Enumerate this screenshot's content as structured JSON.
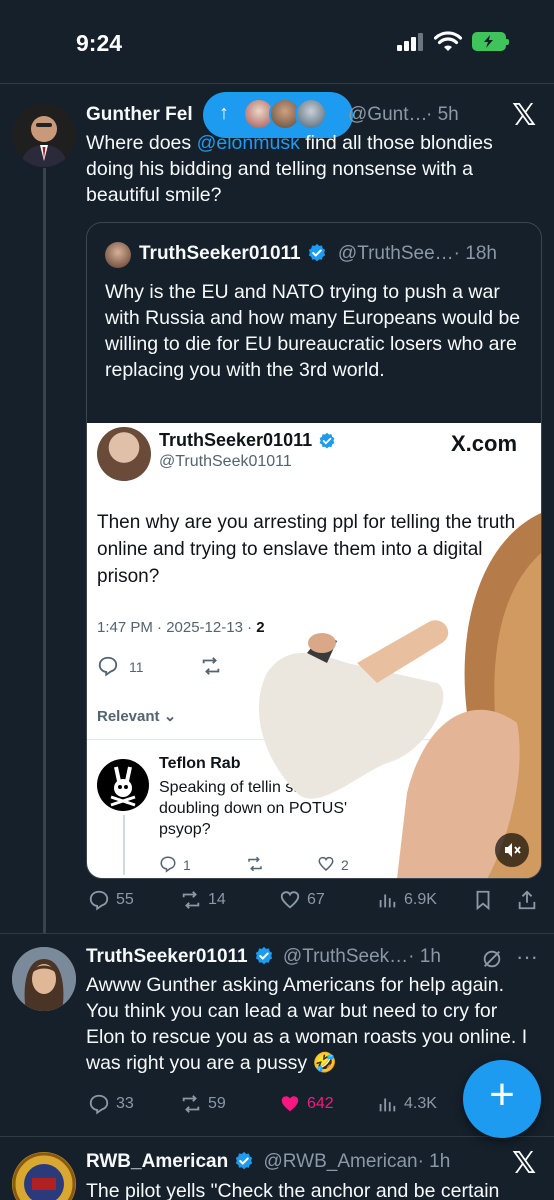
{
  "status_bar": {
    "time": "9:24"
  },
  "new_posts_pill": {
    "arrow": "↑"
  },
  "tweet1": {
    "name": "Gunther Fel",
    "handle": "@Gunt…",
    "time": "· 5h",
    "text_before": "Where does ",
    "mention": "@elonmusk",
    "text_after": " find all those blondies doing his bidding and telling nonsense with a beautiful smile?",
    "quote": {
      "name": "TruthSeeker01011",
      "handle": "@TruthSee…",
      "time": "· 18h",
      "text": "Why is the EU and NATO trying to push a war with Russia and how many  Europeans would be willing to die for EU bureaucratic losers who are replacing you with the 3rd world.",
      "media": {
        "name": "TruthSeeker01011",
        "handle": "@TruthSeek01011",
        "xcom": "X.com",
        "text": "Then why are you arresting ppl for telling the truth online and trying to enslave them into a digital prison?",
        "date": "1:47 PM · 2025-12-13 · ",
        "date_bold": "2",
        "reply_count": "11",
        "relevant": "Relevant",
        "reply_name": "Teflon Rab",
        "reply_text": "Speaking of tellin still doubling down on POTUS' psyop?",
        "reply_reply_count": "1",
        "reply_like_count": "2"
      }
    },
    "stats": {
      "replies": "55",
      "reposts": "14",
      "likes": "67",
      "views": "6.9K"
    }
  },
  "tweet2": {
    "name": "TruthSeeker01011",
    "handle": "@TruthSeek…",
    "time": "· 1h",
    "text": "Awww Gunther asking Americans for help again. You think you can lead a war but need to cry for Elon to rescue you as a woman roasts you online. I was right you are a pussy 🤣",
    "stats": {
      "replies": "33",
      "reposts": "59",
      "likes": "642",
      "views": "4.3K"
    },
    "more": "···"
  },
  "tweet3": {
    "name": "RWB_American",
    "handle": "@RWB_American",
    "time": "· 1h",
    "text": "The pilot yells \"Check the anchor and be certain"
  },
  "fab": {
    "label": "+"
  },
  "colors": {
    "accent": "#1d9bf0",
    "background": "#15202b",
    "like_active": "#f91880"
  }
}
